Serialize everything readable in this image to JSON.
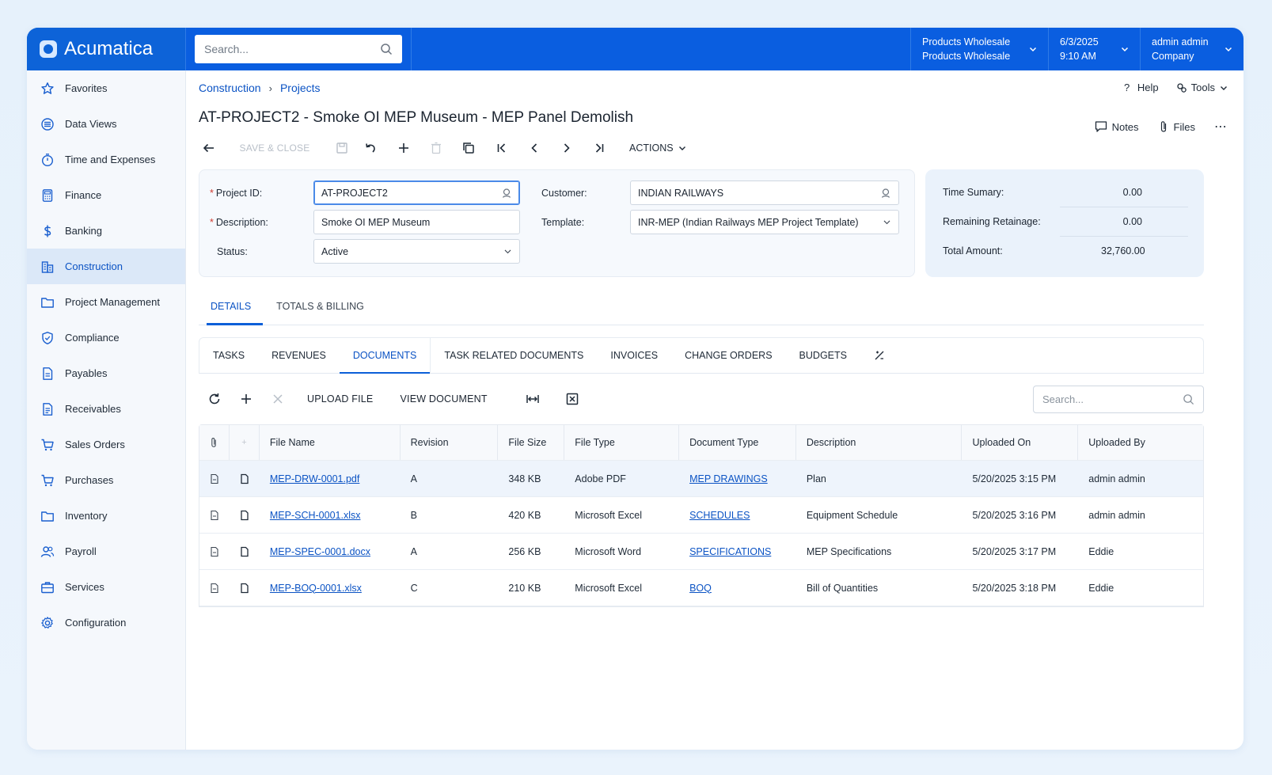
{
  "app": {
    "brand": "Acumatica",
    "search_placeholder": "Search...",
    "branch": {
      "line1": "Products Wholesale",
      "line2": "Products Wholesale"
    },
    "datetime": {
      "date": "6/3/2025",
      "time": "9:10 AM"
    },
    "user": {
      "name": "admin admin",
      "company": "Company"
    }
  },
  "sidebar": {
    "items": [
      {
        "label": "Favorites",
        "icon": "star-icon"
      },
      {
        "label": "Data Views",
        "icon": "data-views-icon"
      },
      {
        "label": "Time and Expenses",
        "icon": "timer-icon"
      },
      {
        "label": "Finance",
        "icon": "calculator-icon"
      },
      {
        "label": "Banking",
        "icon": "dollar-icon"
      },
      {
        "label": "Construction",
        "icon": "building-icon",
        "active": true
      },
      {
        "label": "Project Management",
        "icon": "folder-icon"
      },
      {
        "label": "Compliance",
        "icon": "shield-icon"
      },
      {
        "label": "Payables",
        "icon": "document-icon"
      },
      {
        "label": "Receivables",
        "icon": "document-list-icon"
      },
      {
        "label": "Sales Orders",
        "icon": "cart-icon"
      },
      {
        "label": "Purchases",
        "icon": "cart-icon"
      },
      {
        "label": "Inventory",
        "icon": "folder-icon"
      },
      {
        "label": "Payroll",
        "icon": "users-icon"
      },
      {
        "label": "Services",
        "icon": "briefcase-icon"
      },
      {
        "label": "Configuration",
        "icon": "gear-icon"
      }
    ]
  },
  "breadcrumb": {
    "root": "Construction",
    "current": "Projects"
  },
  "header": {
    "help": "Help",
    "tools": "Tools",
    "title": "AT-PROJECT2 - Smoke OI MEP Museum - MEP Panel Demolish",
    "notes": "Notes",
    "files": "Files"
  },
  "toolbar": {
    "save_close": "SAVE & CLOSE",
    "actions": "ACTIONS"
  },
  "form": {
    "project_id_label": "Project ID:",
    "project_id": "AT-PROJECT2",
    "description_label": "Description:",
    "description": "Smoke OI MEP Museum",
    "status_label": "Status:",
    "status": "Active",
    "customer_label": "Customer:",
    "customer": "INDIAN RAILWAYS",
    "template_label": "Template:",
    "template": "INR-MEP (Indian Railways MEP Project Template)"
  },
  "totals": {
    "time_summary_label": "Time Sumary:",
    "time_summary": "0.00",
    "remaining_retainage_label": "Remaining Retainage:",
    "remaining_retainage": "0.00",
    "total_amount_label": "Total Amount:",
    "total_amount": "32,760.00"
  },
  "main_tabs": [
    "DETAILS",
    "TOTALS & BILLING"
  ],
  "sub_tabs": [
    "TASKS",
    "REVENUES",
    "DOCUMENTS",
    "TASK RELATED DOCUMENTS",
    "INVOICES",
    "CHANGE ORDERS",
    "BUDGETS"
  ],
  "grid_toolbar": {
    "upload": "UPLOAD FILE",
    "view": "VIEW DOCUMENT",
    "search_placeholder": "Search..."
  },
  "table": {
    "columns": [
      "File Name",
      "Revision",
      "File Size",
      "File Type",
      "Document Type",
      "Description",
      "Uploaded On",
      "Uploaded By"
    ],
    "rows": [
      {
        "file": "MEP-DRW-0001.pdf",
        "rev": "A",
        "size": "348 KB",
        "type": "Adobe PDF",
        "doctype": "MEP DRAWINGS",
        "desc": "Plan",
        "on": "5/20/2025 3:15 PM",
        "by": "admin admin"
      },
      {
        "file": "MEP-SCH-0001.xlsx",
        "rev": "B",
        "size": "420 KB",
        "type": "Microsoft Excel",
        "doctype": "SCHEDULES",
        "desc": "Equipment Schedule",
        "on": "5/20/2025 3:16 PM",
        "by": "admin admin"
      },
      {
        "file": "MEP-SPEC-0001.docx",
        "rev": "A",
        "size": "256 KB",
        "type": "Microsoft Word",
        "doctype": "SPECIFICATIONS",
        "desc": "MEP Specifications",
        "on": "5/20/2025 3:17 PM",
        "by": "Eddie"
      },
      {
        "file": "MEP-BOQ-0001.xlsx",
        "rev": "C",
        "size": "210 KB",
        "type": "Microsoft Excel",
        "doctype": "BOQ",
        "desc": "Bill of Quantities",
        "on": "5/20/2025 3:18 PM",
        "by": "Eddie"
      }
    ]
  }
}
